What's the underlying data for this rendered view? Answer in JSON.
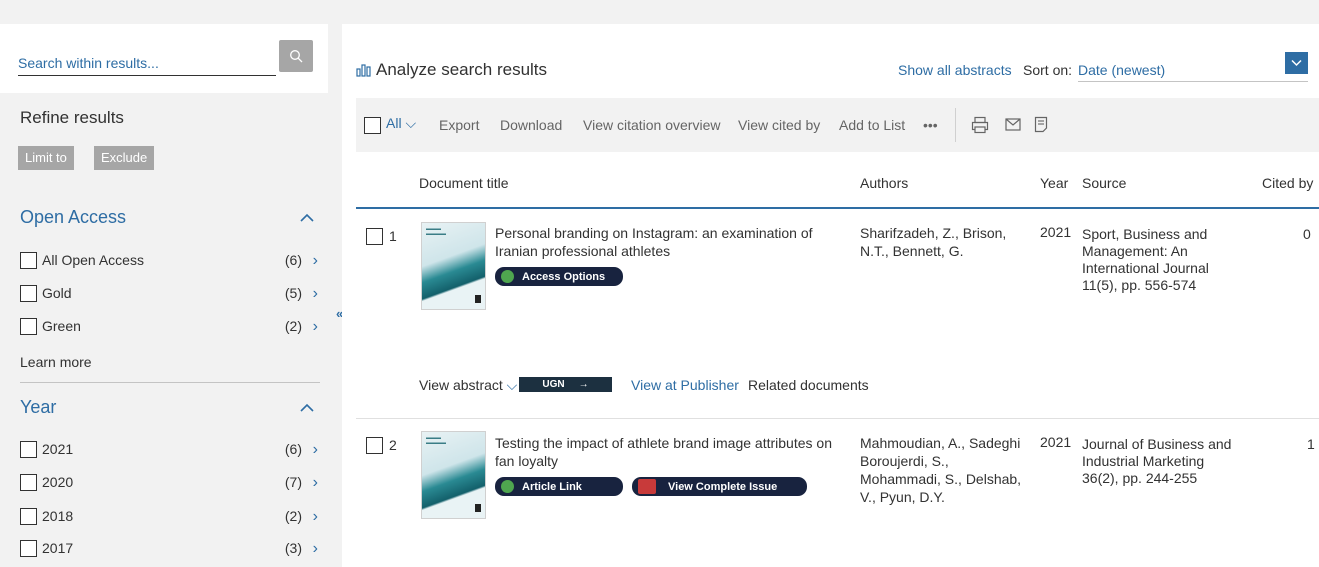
{
  "search": {
    "placeholder": "Search within results..."
  },
  "refine": {
    "title": "Refine results",
    "limit_label": "Limit to",
    "exclude_label": "Exclude"
  },
  "facets": {
    "open_access": {
      "title": "Open Access",
      "items": [
        {
          "label": "All Open Access",
          "count": "(6)"
        },
        {
          "label": "Gold",
          "count": "(5)"
        },
        {
          "label": "Green",
          "count": "(2)"
        }
      ],
      "learn_more": "Learn more"
    },
    "year": {
      "title": "Year",
      "items": [
        {
          "label": "2021",
          "count": "(6)"
        },
        {
          "label": "2020",
          "count": "(7)"
        },
        {
          "label": "2018",
          "count": "(2)"
        },
        {
          "label": "2017",
          "count": "(3)"
        }
      ]
    }
  },
  "header": {
    "analyze": "Analyze search results",
    "show_abstracts": "Show all abstracts",
    "sort_label": "Sort on:",
    "sort_value": "Date (newest)"
  },
  "toolbar": {
    "all": "All",
    "export": "Export",
    "download": "Download",
    "citation_overview": "View citation overview",
    "cited_by": "View cited by",
    "add_to_list": "Add to List",
    "more": "•••"
  },
  "columns": {
    "title": "Document title",
    "authors": "Authors",
    "year": "Year",
    "source": "Source",
    "cited": "Cited by"
  },
  "results": [
    {
      "num": "1",
      "title_l1": "Personal branding on Instagram: an examination of",
      "title_l2": "Iranian professional athletes",
      "button": "Access Options",
      "authors_l1": "Sharifzadeh, Z., Brison,",
      "authors_l2": "N.T., Bennett, G.",
      "year": "2021",
      "source_l1": "Sport, Business and",
      "source_l2": "Management: An",
      "source_l3": "International Journal",
      "source_l4": "11(5), pp. 556-574",
      "cited": "0",
      "view_abstract": "View abstract",
      "ugn": "UGN",
      "view_publisher": "View at Publisher",
      "related": "Related documents"
    },
    {
      "num": "2",
      "title_l1": "Testing the impact of athlete brand image attributes on",
      "title_l2": "fan loyalty",
      "button": "Article Link",
      "button2": "View Complete Issue",
      "authors_l1": "Mahmoudian, A., Sadeghi",
      "authors_l2": "Boroujerdi, S.,",
      "authors_l3": "Mohammadi, S., Delshab,",
      "authors_l4": "V., Pyun, D.Y.",
      "year": "2021",
      "source_l1": "Journal of Business and",
      "source_l2": "Industrial Marketing",
      "source_l3": "36(2), pp. 244-255",
      "cited": "1"
    }
  ]
}
